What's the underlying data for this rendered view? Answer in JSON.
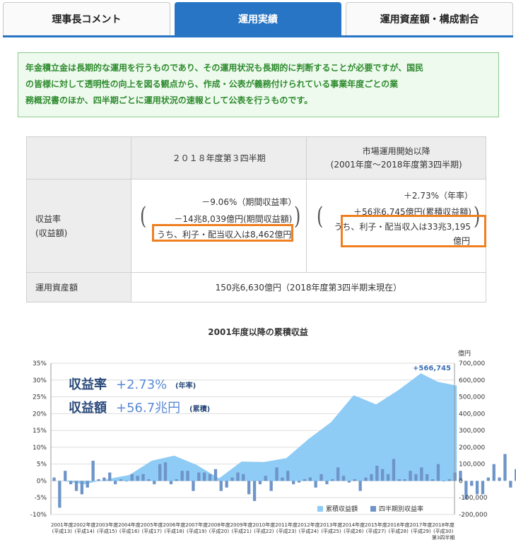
{
  "tabs": [
    {
      "label": "理事長コメント",
      "active": false
    },
    {
      "label": "運用実績",
      "active": true
    },
    {
      "label": "運用資産額・構成割合",
      "active": false
    }
  ],
  "notice": {
    "line1": "年金積立金は長期的な運用を行うものであり、その運用状況も長期的に判断することが必要ですが、国民",
    "line2": "の皆様に対して透明性の向上を図る観点から、作成・公表が義務付けられている事業年度ごとの業",
    "line3": "務概況書のほか、四半期ごとに運用状況の速報として公表を行うものです。"
  },
  "table": {
    "col1_header": "２０１８年度第３四半期",
    "col2_header_1": "市場運用開始以降",
    "col2_header_2": "(2001年度～2018年度第3四半期)",
    "row1_label_1": "収益率",
    "row1_label_2": "(収益額)",
    "q3": {
      "rate": "－9.06%（期間収益率）",
      "amount": "－14兆8,039億円(期間収益額)",
      "income": "うち、利子・配当収入は8,462億円"
    },
    "cumulative": {
      "rate": "＋2.73%（年率）",
      "amount": "＋56兆6,745億円(累積収益額)",
      "income_1": "うち、利子・配当収入は33兆3,195",
      "income_2": "億円"
    },
    "row2_label": "運用資産額",
    "row2_value": "150兆6,630億円（2018年度第3四半期末現在）"
  },
  "chart_title": "2001年度以降の累積収益",
  "chart_data": {
    "type": "bar",
    "title": "2001年度以降の累積収益",
    "left_axis": {
      "ylim": [
        -10,
        35
      ],
      "ticks": [
        "35%",
        "30%",
        "25%",
        "20%",
        "15%",
        "10%",
        "5%",
        "0%",
        "-5%",
        "-10%"
      ]
    },
    "right_axis": {
      "unit": "億円",
      "ylim": [
        -200000,
        700000
      ],
      "ticks": [
        "700,000",
        "600,000",
        "500,000",
        "400,000",
        "300,000",
        "200,000",
        "100,000",
        "0",
        "-100,000",
        "-200,000"
      ]
    },
    "x_labels": [
      {
        "a": "2001年度",
        "b": "(平成13)"
      },
      {
        "a": "2002年度",
        "b": "(平成14)"
      },
      {
        "a": "2003年度",
        "b": "(平成15)"
      },
      {
        "a": "2004年度",
        "b": "(平成16)"
      },
      {
        "a": "2005年度",
        "b": "(平成17)"
      },
      {
        "a": "2006年度",
        "b": "(平成18)"
      },
      {
        "a": "2007年度",
        "b": "(平成19)"
      },
      {
        "a": "2008年度",
        "b": "(平成20)"
      },
      {
        "a": "2009年度",
        "b": "(平成21)"
      },
      {
        "a": "2010年度",
        "b": "(平成22)"
      },
      {
        "a": "2011年度",
        "b": "(平成23)"
      },
      {
        "a": "2012年度",
        "b": "(平成24)"
      },
      {
        "a": "2013年度",
        "b": "(平成25)"
      },
      {
        "a": "2014年度",
        "b": "(平成26)"
      },
      {
        "a": "2015年度",
        "b": "(平成27)"
      },
      {
        "a": "2016年度",
        "b": "(平成28)"
      },
      {
        "a": "2017年度",
        "b": "(平成29)"
      },
      {
        "a": "2018年度",
        "b": "(平成30)",
        "c": "第3四半期"
      }
    ],
    "cumulative_series": {
      "name": "累積収益額",
      "x": [
        0,
        1,
        2,
        3,
        4,
        5,
        6,
        7,
        8,
        9,
        10,
        11,
        12,
        13,
        14,
        15,
        16,
        16.75,
        17.6
      ],
      "values": [
        0,
        -20000,
        10000,
        35000,
        120000,
        150000,
        95000,
        15000,
        115000,
        112000,
        135000,
        250000,
        350000,
        510000,
        455000,
        540000,
        640000,
        590000,
        566745
      ]
    },
    "quarterly_series": {
      "name": "四半期別収益率",
      "values": [
        1,
        -8,
        3,
        -1,
        -3,
        -4,
        -2,
        6,
        0.5,
        1,
        2.5,
        -1,
        0.5,
        0,
        2,
        1.5,
        2,
        0.5,
        -1,
        5,
        5.5,
        -1,
        0.5,
        3,
        3,
        -3,
        2.5,
        2.5,
        2,
        3.5,
        -3,
        -2,
        1,
        2.5,
        2,
        -4,
        -6,
        -1,
        1.5,
        -3,
        4,
        1,
        3,
        -1,
        -0.5,
        0.5,
        1,
        -2,
        2,
        -1,
        0.5,
        4,
        1.5,
        -0.5,
        0.5,
        -3,
        1,
        2,
        4.5,
        3.5,
        2,
        6.5,
        0.5,
        0.5,
        3,
        2,
        4,
        2,
        0.5,
        5,
        0,
        0.5,
        2.5,
        3,
        -5.5,
        -1.5,
        -4,
        -4,
        1,
        5,
        1,
        8,
        -2,
        3.5,
        3,
        3,
        4,
        -1.5,
        1.5,
        3,
        -9
      ]
    },
    "annotation": "+566,745",
    "legend": {
      "cumulative": "累積収益額",
      "quarterly": "四半期別収益率"
    },
    "overlay": {
      "rate_label": "収益率",
      "rate_value": "+2.73%",
      "rate_note": "(年率)",
      "amount_label": "収益額",
      "amount_value": "+56.7兆円",
      "amount_note": "(累積)"
    },
    "colors": {
      "area": "#8ecbf5",
      "bar": "#6e94c8",
      "tick": "#333333"
    }
  }
}
